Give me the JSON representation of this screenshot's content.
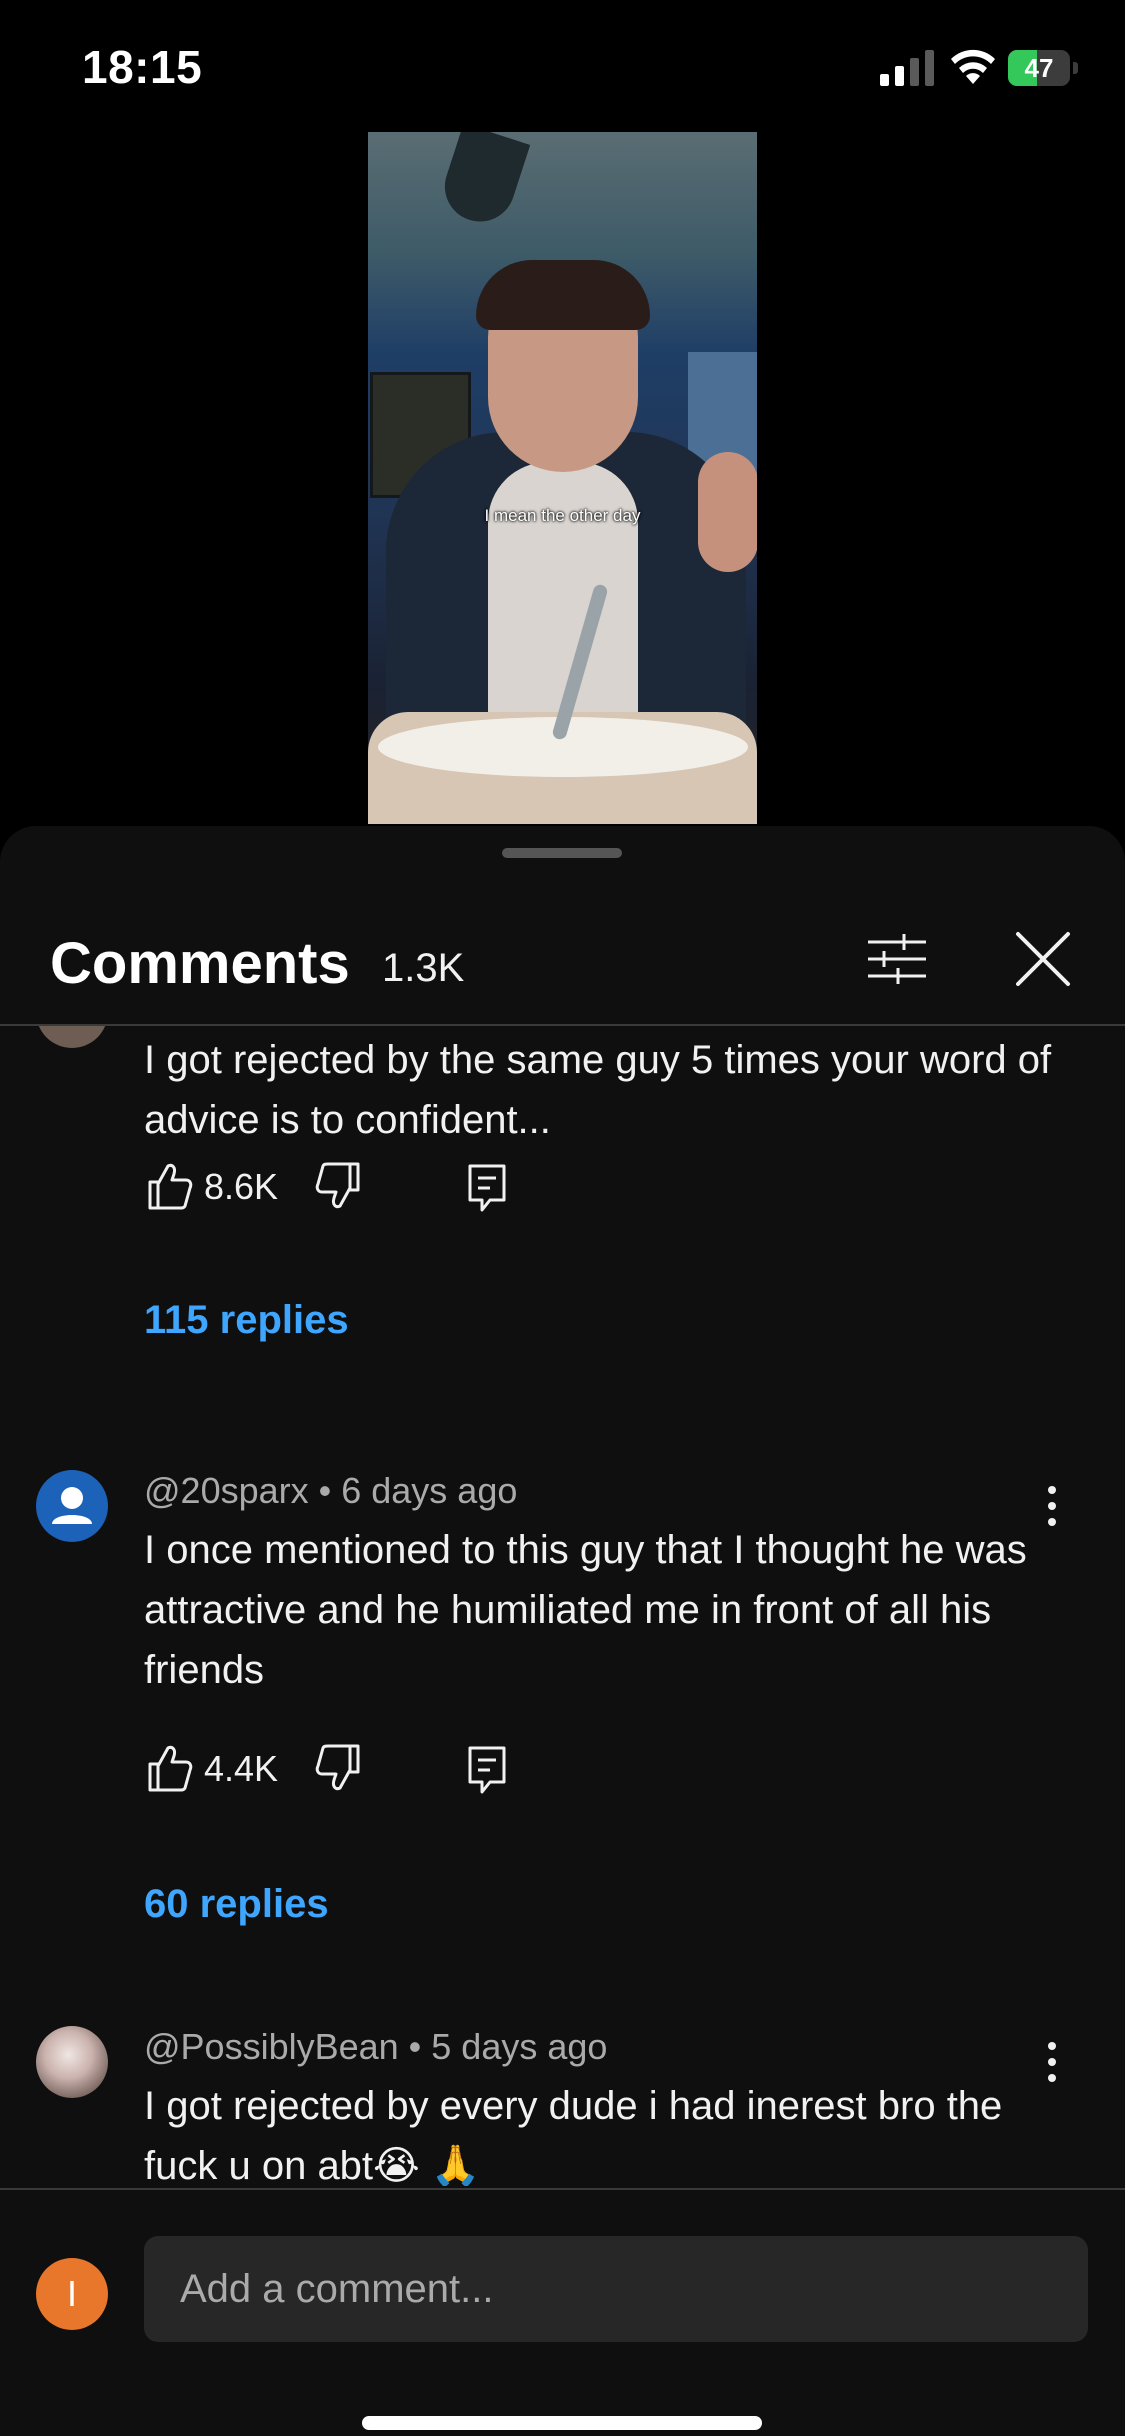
{
  "status_bar": {
    "time": "18:15",
    "battery": "47"
  },
  "video": {
    "caption": "I mean the other day",
    "progress": 0.0
  },
  "sheet": {
    "title": "Comments",
    "count": "1.3K",
    "input_placeholder": "Add a comment...",
    "user_initial": "I"
  },
  "comments": [
    {
      "author": "",
      "age": "",
      "text": "I got rejected by the same guy 5 times your word of advice is to confident...",
      "likes": "8.6K",
      "replies": "115 replies"
    },
    {
      "author": "@20sparx",
      "age": "6 days ago",
      "text": "I once mentioned to this guy that I thought he was attractive and he humiliated me in front of all his friends",
      "likes": "4.4K",
      "replies": "60 replies"
    },
    {
      "author": "@PossiblyBean",
      "age": "5 days ago",
      "text": "I got rejected by every dude i had inerest bro the fuck u on abt😭 🙏",
      "likes": "",
      "replies": ""
    }
  ],
  "icons": {
    "signal": "cellular-signal-icon",
    "wifi": "wifi-icon",
    "battery": "battery-charging-icon",
    "filter": "sliders-filter-icon",
    "close": "close-icon",
    "like": "thumbs-up-icon",
    "dislike": "thumbs-down-icon",
    "reply": "reply-comment-icon",
    "more": "more-vertical-icon"
  },
  "colors": {
    "accent": "#3ea6ff",
    "sheet_bg": "#0f0f0f",
    "battery": "#34c759",
    "user_avatar": "#e8762b"
  }
}
